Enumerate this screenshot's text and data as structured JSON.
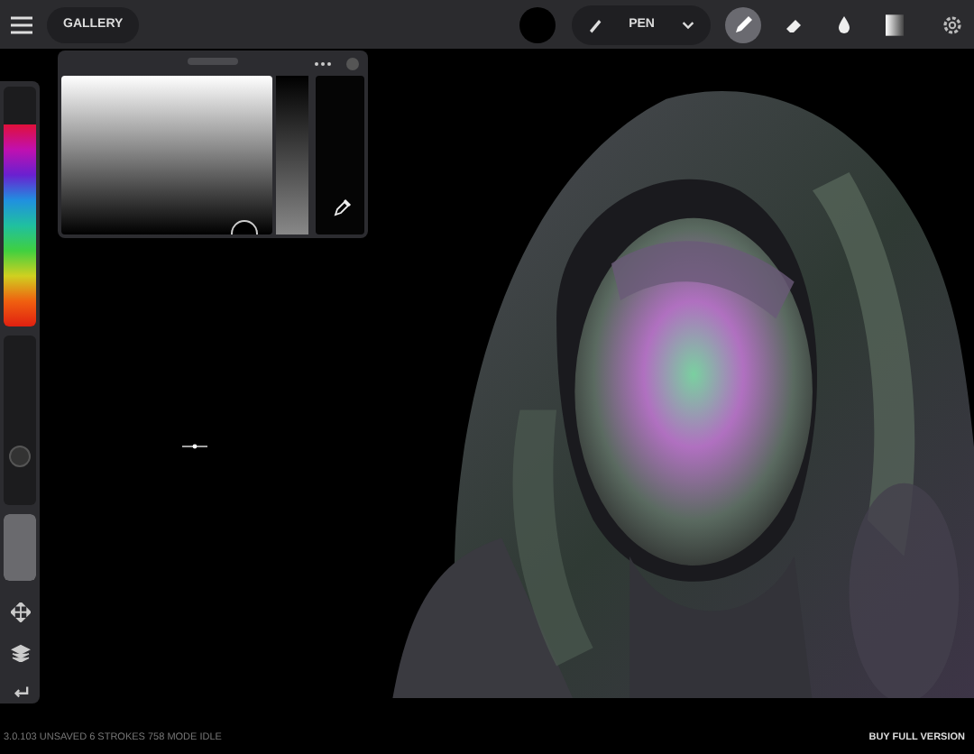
{
  "top_bar": {
    "gallery_button": "GALLERY",
    "brush": {
      "label": "PEN",
      "expanded": false
    },
    "tools": [
      {
        "kind": "pen",
        "selected": true
      },
      {
        "kind": "eraser",
        "selected": false
      },
      {
        "kind": "smudge",
        "selected": false
      },
      {
        "kind": "gradient",
        "selected": false
      }
    ]
  },
  "sidebar": {
    "hue_slider": {
      "level": 0.84
    },
    "size_slider": {
      "level": 0.28
    },
    "opacity_slider": {
      "level": 1
    }
  },
  "status_bar": {
    "text": "3.0.103 UNSAVED 6  STROKES 758  MODE IDLE",
    "upgrade_link": "BUY FULL VERSION"
  }
}
